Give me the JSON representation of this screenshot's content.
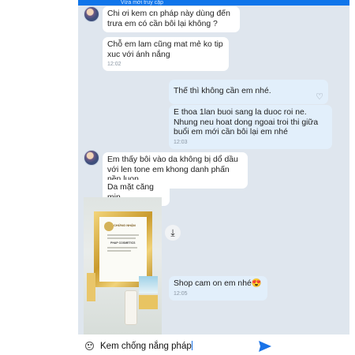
{
  "status_bar": {
    "text": "Vừa mới truy cập"
  },
  "messages": [
    {
      "id": "m1",
      "side": "in",
      "text": "Chi ơi kem cn pháp này dùng đến trưa em có cần bôi lại không ?"
    },
    {
      "id": "m2",
      "side": "in",
      "text": "Chỗ em lam cũng mat mẻ ko tip xuc với ánh nắng",
      "time": "12:02"
    },
    {
      "id": "m3",
      "side": "out",
      "text": "Thế thì không cần em nhé."
    },
    {
      "id": "m4",
      "side": "out",
      "text": "E thoa 1lan buoi sang la duoc roi ne. Nhung neu hoat dong ngoai troi thi giữa buổi em mới cần bôi lại em nhé",
      "time": "12:03"
    },
    {
      "id": "m5",
      "side": "in",
      "text": "Em thấy bôi vào da không bị dổ dầu với len tone em khong danh phấn nền luon"
    },
    {
      "id": "m6",
      "side": "in",
      "text": "Da mặt căng mịn"
    },
    {
      "id": "m7",
      "side": "out",
      "text": "Shop cam on em nhé😍",
      "time": "12:05"
    }
  ],
  "photo": {
    "certificate_title": "CHỨNG NHẬN",
    "brand": "PHAP COSMETICS"
  },
  "input": {
    "value": "Kem chống nắng pháp"
  },
  "colors": {
    "chat_bg": "#dfe6ee",
    "incoming": "#ffffff",
    "outgoing": "#e2effb",
    "send": "#1a73e8",
    "header": "#0f75ea"
  },
  "icons": {
    "emoji": "emoji-icon",
    "send": "send-icon",
    "download": "download-icon",
    "react": "heart-icon"
  }
}
